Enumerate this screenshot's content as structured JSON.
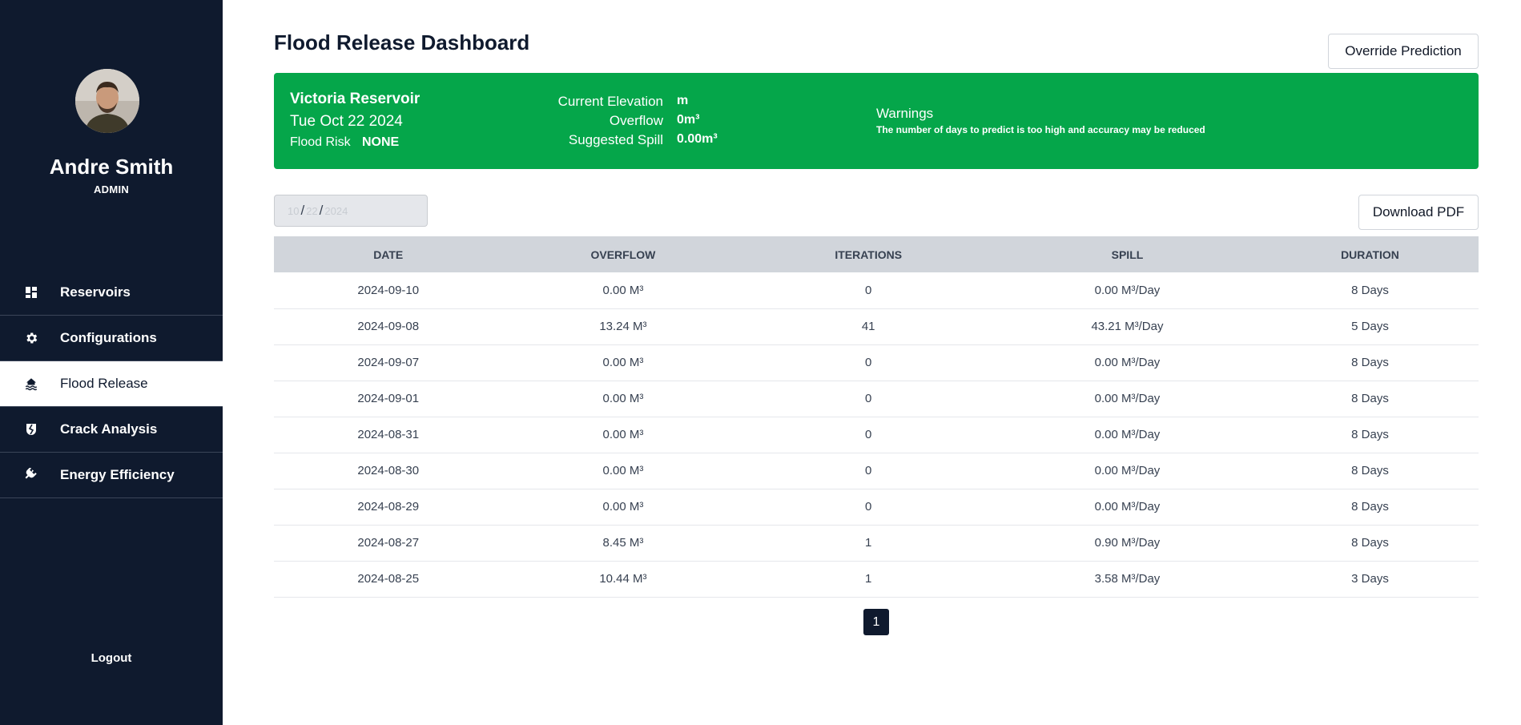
{
  "sidebar": {
    "user": {
      "name": "Andre Smith",
      "role": "ADMIN"
    },
    "items": [
      {
        "label": "Reservoirs",
        "icon": "dashboard-icon",
        "active": false
      },
      {
        "label": "Configurations",
        "icon": "gear-icon",
        "active": false
      },
      {
        "label": "Flood Release",
        "icon": "flood-icon",
        "active": true
      },
      {
        "label": "Crack Analysis",
        "icon": "crack-icon",
        "active": false
      },
      {
        "label": "Energy Efficiency",
        "icon": "plug-icon",
        "active": false
      }
    ],
    "logout_label": "Logout"
  },
  "header": {
    "title": "Flood Release Dashboard",
    "override_label": "Override Prediction"
  },
  "banner": {
    "color": "#05a64a",
    "reservoir_name": "Victoria Reservoir",
    "date": "Tue Oct 22 2024",
    "flood_risk_label": "Flood Risk",
    "flood_risk_value": "NONE",
    "current_elevation_label": "Current Elevation",
    "current_elevation_value": "m",
    "overflow_label": "Overflow",
    "overflow_value": "0m³",
    "suggested_spill_label": "Suggested Spill",
    "suggested_spill_value": "0.00m³",
    "warnings_title": "Warnings",
    "warnings_text": "The number of days to predict is too high and accuracy may be reduced"
  },
  "date_input": {
    "month": "10",
    "day": "22",
    "year": "2024"
  },
  "download_label": "Download PDF",
  "table": {
    "columns": [
      "DATE",
      "OVERFLOW",
      "ITERATIONS",
      "SPILL",
      "DURATION"
    ],
    "rows": [
      [
        "2024-09-10",
        "0.00 M³",
        "0",
        "0.00 M³/Day",
        "8 Days"
      ],
      [
        "2024-09-08",
        "13.24 M³",
        "41",
        "43.21 M³/Day",
        "5 Days"
      ],
      [
        "2024-09-07",
        "0.00 M³",
        "0",
        "0.00 M³/Day",
        "8 Days"
      ],
      [
        "2024-09-01",
        "0.00 M³",
        "0",
        "0.00 M³/Day",
        "8 Days"
      ],
      [
        "2024-08-31",
        "0.00 M³",
        "0",
        "0.00 M³/Day",
        "8 Days"
      ],
      [
        "2024-08-30",
        "0.00 M³",
        "0",
        "0.00 M³/Day",
        "8 Days"
      ],
      [
        "2024-08-29",
        "0.00 M³",
        "0",
        "0.00 M³/Day",
        "8 Days"
      ],
      [
        "2024-08-27",
        "8.45 M³",
        "1",
        "0.90 M³/Day",
        "8 Days"
      ],
      [
        "2024-08-25",
        "10.44 M³",
        "1",
        "3.58 M³/Day",
        "3 Days"
      ]
    ]
  },
  "pagination": {
    "current": "1"
  }
}
